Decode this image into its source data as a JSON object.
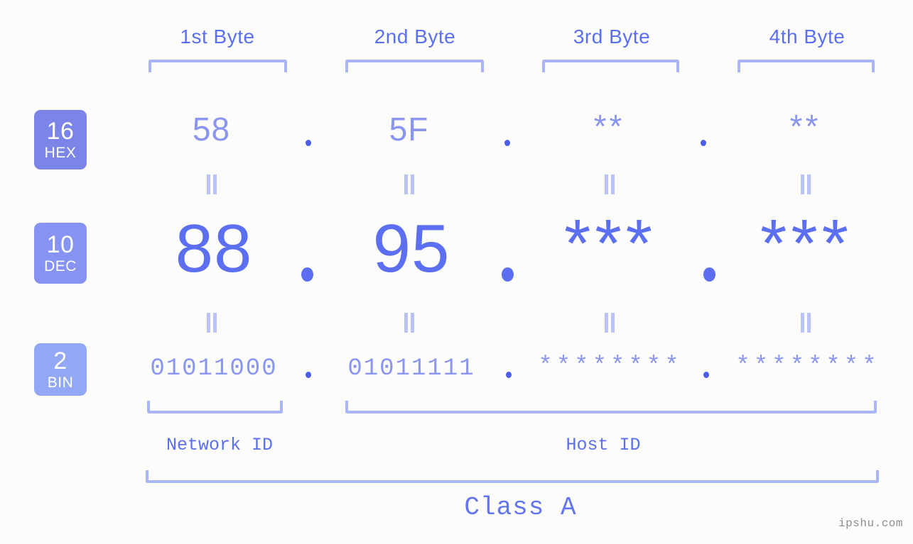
{
  "colors": {
    "background": "#fcfdfa",
    "accent_strong": "#5c6ff0",
    "accent_mid": "#8a95ef",
    "accent_light": "#a9b5f7",
    "badge_hex": "#7b85e8",
    "badge_dec": "#8693f2",
    "badge_bin": "#93a8f4",
    "watermark": "#8d8d8d"
  },
  "headers": [
    {
      "label": "1st Byte"
    },
    {
      "label": "2nd Byte"
    },
    {
      "label": "3rd Byte"
    },
    {
      "label": "4th Byte"
    }
  ],
  "rows": [
    {
      "badge_num": "16",
      "badge_unit": "HEX",
      "values": [
        "58",
        "5F",
        "**",
        "**"
      ],
      "separator": "."
    },
    {
      "badge_num": "10",
      "badge_unit": "DEC",
      "values": [
        "88",
        "95",
        "***",
        "***"
      ],
      "separator": "."
    },
    {
      "badge_num": "2",
      "badge_unit": "BIN",
      "values": [
        "01011000",
        "01011111",
        "********",
        "********"
      ],
      "separator": "."
    }
  ],
  "equals_marks": {
    "glyph": "||",
    "count_per_gap": 4
  },
  "footer": {
    "network_id_label": "Network ID",
    "host_id_label": "Host ID",
    "class_label": "Class A"
  },
  "watermark": "ipshu.com"
}
